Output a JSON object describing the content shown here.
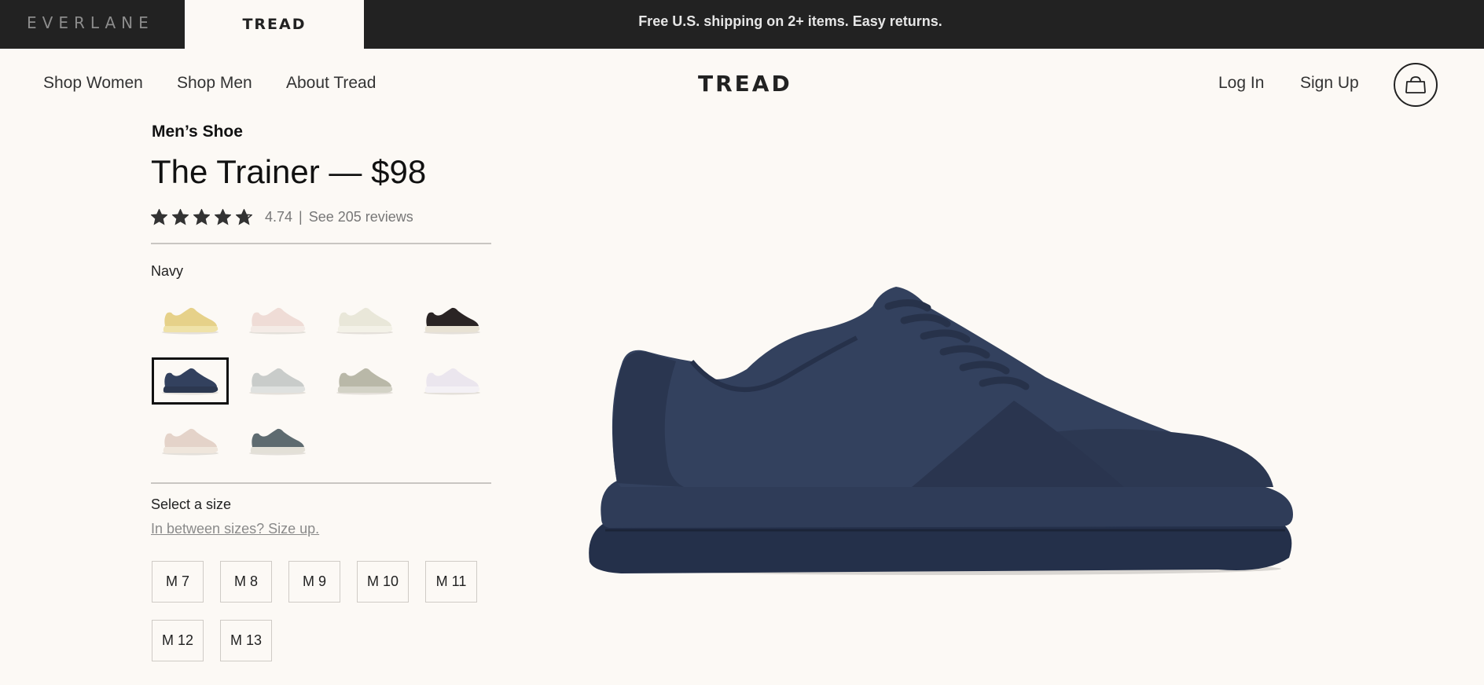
{
  "topbar": {
    "brand_left": "EVERLANE",
    "brand_tab": "TREAD",
    "promo": "Free U.S. shipping on 2+ items. Easy returns."
  },
  "nav": {
    "left": [
      "Shop Women",
      "Shop Men",
      "About Tread"
    ],
    "logo": "TREAD",
    "login": "Log In",
    "signup": "Sign Up",
    "cart_icon": "bag-icon"
  },
  "product": {
    "category": "Men’s Shoe",
    "title": "The Trainer — $98",
    "rating": "4.74",
    "rating_stars": 4.74,
    "separator": "|",
    "reviews_link": "See 205 reviews",
    "color_label": "Navy",
    "swatches": [
      {
        "name": "Yellow",
        "upper": "#e6d189",
        "sole": "#efe2a8",
        "selected": false
      },
      {
        "name": "Pink",
        "upper": "#efdcd6",
        "sole": "#f4ebe6",
        "selected": false
      },
      {
        "name": "Cream",
        "upper": "#e9e7d9",
        "sole": "#f3f1e7",
        "selected": false
      },
      {
        "name": "Black",
        "upper": "#2a2424",
        "sole": "#e8e2d4",
        "selected": false
      },
      {
        "name": "Navy",
        "upper": "#33415e",
        "sole": "#2c3850",
        "selected": true
      },
      {
        "name": "Light Grey",
        "upper": "#c9ccca",
        "sole": "#dfe1df",
        "selected": false
      },
      {
        "name": "Sage Grey",
        "upper": "#b9b8a8",
        "sole": "#d3d2c6",
        "selected": false
      },
      {
        "name": "Lavender White",
        "upper": "#ebe6ee",
        "sole": "#f4f1f5",
        "selected": false
      },
      {
        "name": "Blush",
        "upper": "#e4d3c9",
        "sole": "#efe6dc",
        "selected": false
      },
      {
        "name": "Slate",
        "upper": "#5e6b70",
        "sole": "#e3e0d7",
        "selected": false
      }
    ],
    "size_label": "Select a size",
    "size_up": "In between sizes? Size up.",
    "sizes": [
      "M 7",
      "M 8",
      "M 9",
      "M 10",
      "M 11",
      "M 12",
      "M 13"
    ]
  },
  "colors": {
    "topbar_bg": "#222222",
    "page_bg": "#fcf9f5",
    "hero_shoe": "#2d3b55"
  }
}
